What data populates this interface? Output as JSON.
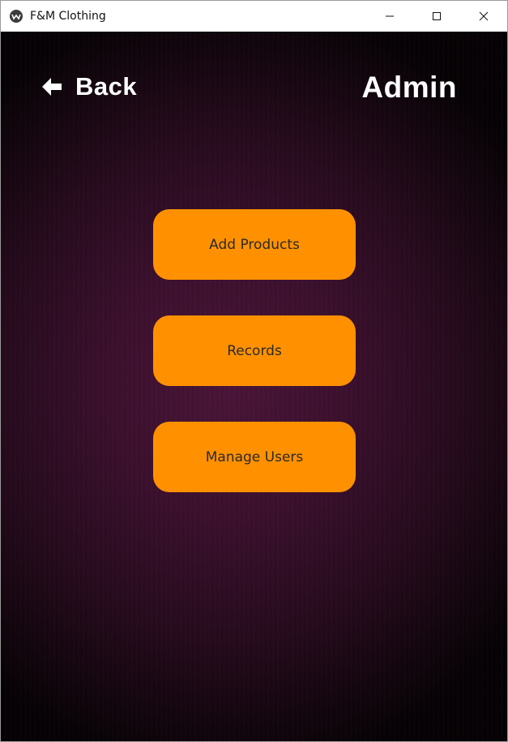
{
  "window": {
    "title": "F&M Clothing",
    "minimize_icon": "minimize-icon",
    "maximize_icon": "maximize-icon",
    "close_icon": "close-icon"
  },
  "header": {
    "back_label": "Back",
    "back_icon": "arrow-left-icon",
    "title": "Admin"
  },
  "menu": {
    "items": [
      {
        "label": "Add Products"
      },
      {
        "label": "Records"
      },
      {
        "label": "Manage Users"
      }
    ]
  },
  "colors": {
    "button_bg": "#ff9100",
    "button_text": "#2a2a2a",
    "background": "#3a0f2c",
    "header_text": "#ffffff"
  }
}
